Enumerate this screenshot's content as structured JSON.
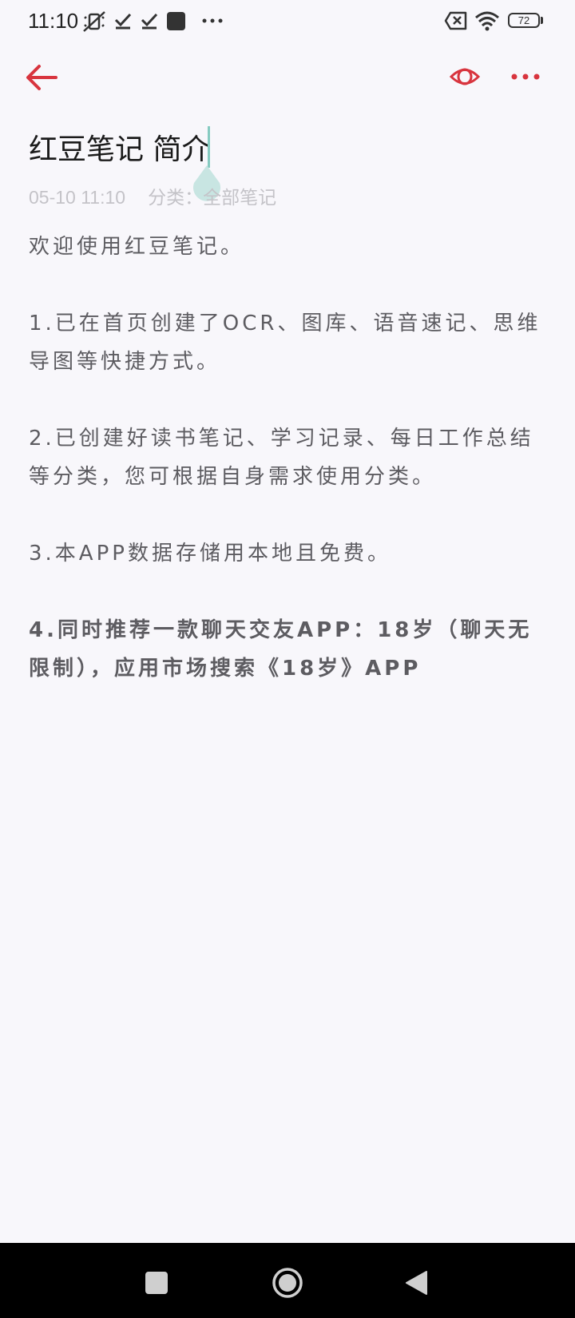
{
  "status_bar": {
    "time": "11:10",
    "battery_level": "72",
    "icons": [
      "mute-vibrate-icon",
      "check-icon",
      "check-icon",
      "app-square-icon",
      "more-dots-icon",
      "no-sim-icon",
      "wifi-icon",
      "battery-icon"
    ]
  },
  "toolbar": {
    "back_icon": "arrow-left-icon",
    "preview_icon": "eye-icon",
    "more_icon": "more-horizontal-icon",
    "accent_color": "#d8343e"
  },
  "note": {
    "title": "红豆笔记 简介",
    "date": "05-10 11:10",
    "category_label": "分类：",
    "category_value": "全部笔记",
    "paragraphs": [
      "欢迎使用红豆笔记。",
      "1.已在首页创建了OCR、图库、语音速记、思维导图等快捷方式。",
      "2.已创建好读书笔记、学习记录、每日工作总结等分类，您可根据自身需求使用分类。",
      "3.本APP数据存储用本地且免费。"
    ],
    "bold_paragraph": "4.同时推荐一款聊天交友APP：18岁（聊天无限制），应用市场搜索《18岁》APP"
  },
  "nav_bar": {
    "recents_icon": "square-icon",
    "home_icon": "circle-icon",
    "back_icon": "triangle-back-icon"
  }
}
